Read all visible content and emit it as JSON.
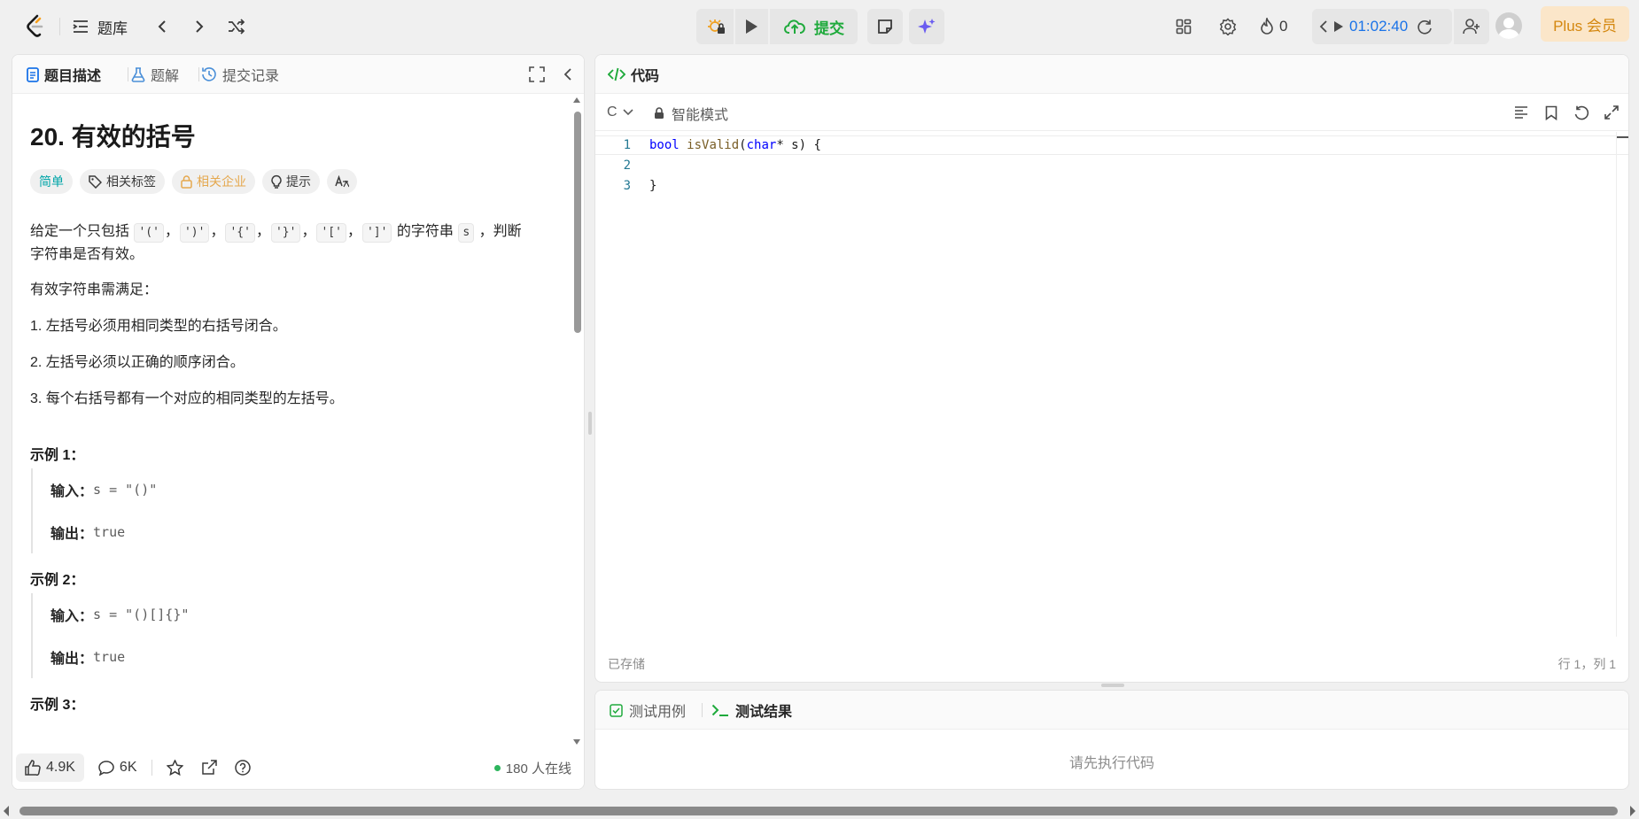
{
  "topbar": {
    "problem_list_label": "题库",
    "submit_label": "提交",
    "streak_count": "0",
    "timer": "01:02:40",
    "plus_label": "Plus 会员"
  },
  "left_panel": {
    "tabs": [
      {
        "label": "题目描述"
      },
      {
        "label": "题解"
      },
      {
        "label": "提交记录"
      }
    ],
    "title": "20. 有效的括号",
    "tags": {
      "difficulty": "简单",
      "related_tags": "相关标签",
      "related_companies": "相关企业",
      "hint": "提示"
    },
    "description": {
      "intro_before": "给定一个只包括 ",
      "chips": [
        "'('",
        "')'",
        "'{'",
        "'}'",
        "'['",
        "']'"
      ],
      "intro_after": " 的字符串 ",
      "var_s": "s",
      "intro_end": " ，判断",
      "intro_line2": "字符串是否有效。",
      "rules_heading": "有效字符串需满足：",
      "rules": [
        "1. 左括号必须用相同类型的右括号闭合。",
        "2. 左括号必须以正确的顺序闭合。",
        "3. 每个右括号都有一个对应的相同类型的左括号。"
      ]
    },
    "examples": [
      {
        "title": "示例 1：",
        "input_label": "输入：",
        "input": "s = \"()\"",
        "output_label": "输出：",
        "output": "true"
      },
      {
        "title": "示例 2：",
        "input_label": "输入：",
        "input": "s = \"()[]{}\"",
        "output_label": "输出：",
        "output": "true"
      },
      {
        "title": "示例 3："
      }
    ],
    "footer": {
      "likes": "4.9K",
      "comments": "6K",
      "online": "180 人在线"
    }
  },
  "code_panel": {
    "header": "代码",
    "language": "C",
    "mode": "智能模式",
    "lines": [
      {
        "num": "1"
      },
      {
        "num": "2"
      },
      {
        "num": "3"
      }
    ],
    "code": {
      "kw_bool": "bool",
      "fn_name": "isValid",
      "paren_open": "(",
      "ty_char": "char",
      "param": "* s) {",
      "close": "}"
    },
    "saved_label": "已存储",
    "cursor_pos": "行 1，列 1"
  },
  "test_panel": {
    "tabs": [
      {
        "label": "测试用例"
      },
      {
        "label": "测试结果"
      }
    ],
    "placeholder": "请先执行代码"
  },
  "colors": {
    "accent_green": "#1faa3c",
    "timer_blue": "#1a73e8",
    "plus_gold": "#d4870f",
    "easy_teal": "#00a5a8"
  }
}
